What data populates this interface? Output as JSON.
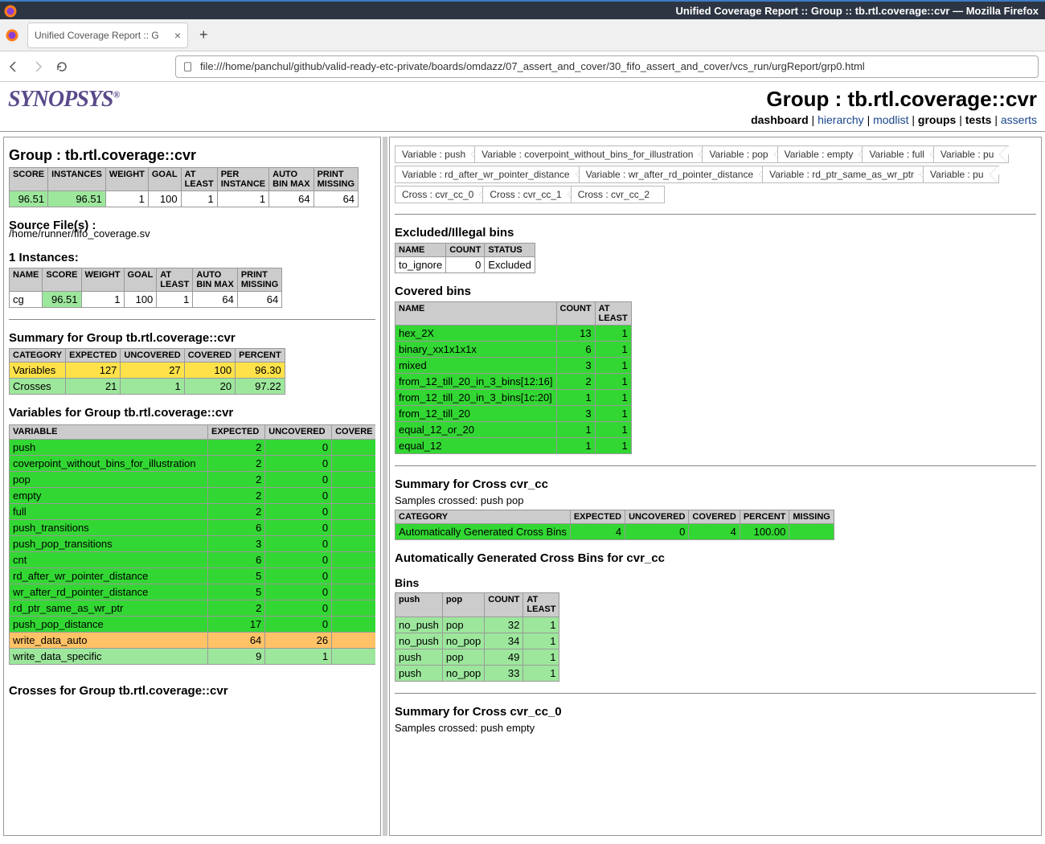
{
  "window": {
    "title": "Unified Coverage Report :: Group :: tb.rtl.coverage::cvr — Mozilla Firefox",
    "tab_title": "Unified Coverage Report :: G",
    "url": "file:///home/panchul/github/valid-ready-etc-private/boards/omdazz/07_assert_and_cover/30_fifo_assert_and_cover/vcs_run/urgReport/grp0.html"
  },
  "header": {
    "logo": "SYNOPSYS",
    "title": "Group : tb.rtl.coverage::cvr",
    "nav": {
      "dashboard": "dashboard",
      "hierarchy": "hierarchy",
      "modlist": "modlist",
      "groups": "groups",
      "tests": "tests",
      "asserts": "asserts"
    }
  },
  "left": {
    "group_heading": "Group : tb.rtl.coverage::cvr",
    "group_table": {
      "headers": [
        "SCORE",
        "INSTANCES",
        "WEIGHT",
        "GOAL",
        "AT LEAST",
        "PER INSTANCE",
        "AUTO BIN MAX",
        "PRINT MISSING"
      ],
      "row": [
        "96.51",
        "96.51",
        "1",
        "100",
        "1",
        "1",
        "64",
        "64"
      ]
    },
    "source_label": "Source File(s) :",
    "source_file": "/home/runner/fifo_coverage.sv",
    "instances_heading": "1 Instances:",
    "instances_table": {
      "headers": [
        "NAME",
        "SCORE",
        "WEIGHT",
        "GOAL",
        "AT LEAST",
        "AUTO BIN MAX",
        "PRINT MISSING"
      ],
      "row": [
        "cg",
        "96.51",
        "1",
        "100",
        "1",
        "64",
        "64"
      ]
    },
    "summary_heading": "Summary for Group tb.rtl.coverage::cvr",
    "summary_table": {
      "headers": [
        "CATEGORY",
        "EXPECTED",
        "UNCOVERED",
        "COVERED",
        "PERCENT"
      ],
      "rows": [
        {
          "cells": [
            "Variables",
            "127",
            "27",
            "100",
            "96.30"
          ],
          "css": "bg-yellow"
        },
        {
          "cells": [
            "Crosses",
            "21",
            "1",
            "20",
            "97.22"
          ],
          "css": "bg-lgreen"
        }
      ]
    },
    "vars_heading": "Variables for Group tb.rtl.coverage::cvr",
    "vars_table": {
      "headers": [
        "VARIABLE",
        "EXPECTED",
        "UNCOVERED",
        "COVERE"
      ],
      "rows": [
        {
          "cells": [
            "push",
            "2",
            "0"
          ],
          "css": "bg-green"
        },
        {
          "cells": [
            "coverpoint_without_bins_for_illustration",
            "2",
            "0"
          ],
          "css": "bg-green"
        },
        {
          "cells": [
            "pop",
            "2",
            "0"
          ],
          "css": "bg-green"
        },
        {
          "cells": [
            "empty",
            "2",
            "0"
          ],
          "css": "bg-green"
        },
        {
          "cells": [
            "full",
            "2",
            "0"
          ],
          "css": "bg-green"
        },
        {
          "cells": [
            "push_transitions",
            "6",
            "0"
          ],
          "css": "bg-green"
        },
        {
          "cells": [
            "push_pop_transitions",
            "3",
            "0"
          ],
          "css": "bg-green"
        },
        {
          "cells": [
            "cnt",
            "6",
            "0"
          ],
          "css": "bg-green"
        },
        {
          "cells": [
            "rd_after_wr_pointer_distance",
            "5",
            "0"
          ],
          "css": "bg-green"
        },
        {
          "cells": [
            "wr_after_rd_pointer_distance",
            "5",
            "0"
          ],
          "css": "bg-green"
        },
        {
          "cells": [
            "rd_ptr_same_as_wr_ptr",
            "2",
            "0"
          ],
          "css": "bg-green"
        },
        {
          "cells": [
            "push_pop_distance",
            "17",
            "0"
          ],
          "css": "bg-green"
        },
        {
          "cells": [
            "write_data_auto",
            "64",
            "26"
          ],
          "css": "bg-orange"
        },
        {
          "cells": [
            "write_data_specific",
            "9",
            "1"
          ],
          "css": "bg-lgreen"
        }
      ]
    },
    "crosses_heading": "Crosses for Group tb.rtl.coverage::cvr"
  },
  "right": {
    "chips": [
      "Variable : push",
      "Variable : coverpoint_without_bins_for_illustration",
      "Variable : pop",
      "Variable : empty",
      "Variable : full",
      "Variable : pu",
      "Variable : rd_after_wr_pointer_distance",
      "Variable : wr_after_rd_pointer_distance",
      "Variable : rd_ptr_same_as_wr_ptr",
      "Variable : pu",
      "Cross : cvr_cc_0",
      "Cross : cvr_cc_1",
      "Cross : cvr_cc_2"
    ],
    "excluded_heading": "Excluded/Illegal bins",
    "excluded_table": {
      "headers": [
        "NAME",
        "COUNT",
        "STATUS"
      ],
      "row": [
        "to_ignore",
        "0",
        "Excluded"
      ]
    },
    "covered_heading": "Covered bins",
    "covered_table": {
      "headers": [
        "NAME",
        "COUNT",
        "AT LEAST"
      ],
      "rows": [
        [
          "hex_2X",
          "13",
          "1"
        ],
        [
          "binary_xx1x1x1x",
          "6",
          "1"
        ],
        [
          "mixed",
          "3",
          "1"
        ],
        [
          "from_12_till_20_in_3_bins[12:16]",
          "2",
          "1"
        ],
        [
          "from_12_till_20_in_3_bins[1c:20]",
          "1",
          "1"
        ],
        [
          "from_12_till_20",
          "3",
          "1"
        ],
        [
          "equal_12_or_20",
          "1",
          "1"
        ],
        [
          "equal_12",
          "1",
          "1"
        ]
      ]
    },
    "cross_heading": "Summary for Cross cvr_cc",
    "cross_samples": "Samples crossed: push pop",
    "cross_table": {
      "headers": [
        "CATEGORY",
        "EXPECTED",
        "UNCOVERED",
        "COVERED",
        "PERCENT",
        "MISSING"
      ],
      "row": [
        "Automatically Generated Cross Bins",
        "4",
        "0",
        "4",
        "100.00",
        ""
      ]
    },
    "auto_heading": "Automatically Generated Cross Bins for cvr_cc",
    "bins_heading": "Bins",
    "bins_table": {
      "headers": [
        "push",
        "pop",
        "COUNT",
        "AT LEAST"
      ],
      "rows": [
        [
          "no_push",
          "pop",
          "32",
          "1"
        ],
        [
          "no_push",
          "no_pop",
          "34",
          "1"
        ],
        [
          "push",
          "pop",
          "49",
          "1"
        ],
        [
          "push",
          "no_pop",
          "33",
          "1"
        ]
      ]
    },
    "cc0_heading": "Summary for Cross cvr_cc_0",
    "cc0_samples": "Samples crossed: push empty"
  }
}
